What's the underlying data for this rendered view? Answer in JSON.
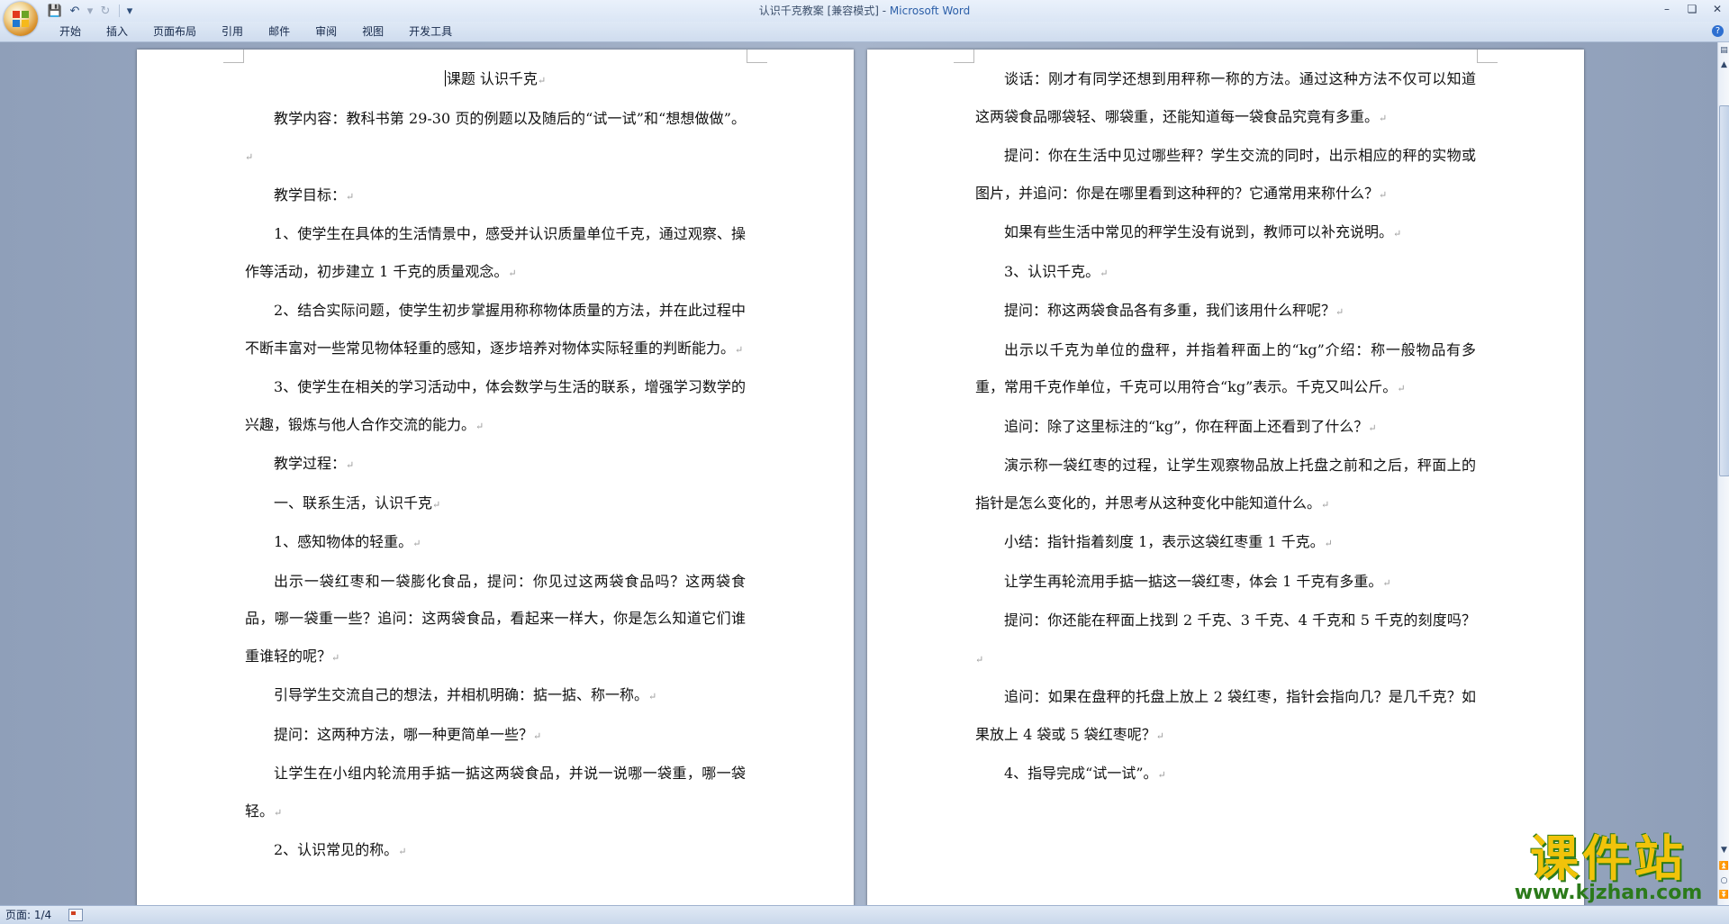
{
  "window": {
    "title_doc": "认识千克教案 [兼容模式] - ",
    "title_app": "Microsoft Word"
  },
  "ribbon": {
    "tabs": [
      "开始",
      "插入",
      "页面布局",
      "引用",
      "邮件",
      "审阅",
      "视图",
      "开发工具"
    ]
  },
  "page_left": {
    "paragraphs": [
      {
        "text": "课题    认识千克",
        "style": "title"
      },
      {
        "text": "教学内容：教科书第 29-30 页的例题以及随后的“试一试”和“想想做做”。"
      },
      {
        "text": "教学目标："
      },
      {
        "text": "1、使学生在具体的生活情景中，感受并认识质量单位千克，通过观察、操作等活动，初步建立 1 千克的质量观念。"
      },
      {
        "text": "2、结合实际问题，使学生初步掌握用称称物体质量的方法，并在此过程中不断丰富对一些常见物体轻重的感知，逐步培养对物体实际轻重的判断能力。"
      },
      {
        "text": "3、使学生在相关的学习活动中，体会数学与生活的联系，增强学习数学的兴趣，锻炼与他人合作交流的能力。"
      },
      {
        "text": "教学过程："
      },
      {
        "text": "一、联系生活，认识千克"
      },
      {
        "text": "1、感知物体的轻重。"
      },
      {
        "text": "出示一袋红枣和一袋膨化食品，提问：你见过这两袋食品吗？这两袋食品，哪一袋重一些？追问：这两袋食品，看起来一样大，你是怎么知道它们谁重谁轻的呢？"
      },
      {
        "text": "引导学生交流自己的想法，并相机明确：掂一掂、称一称。"
      },
      {
        "text": "提问：这两种方法，哪一种更简单一些？"
      },
      {
        "text": "让学生在小组内轮流用手掂一掂这两袋食品，并说一说哪一袋重，哪一袋轻。"
      },
      {
        "text": "2、认识常见的称。"
      }
    ]
  },
  "page_right": {
    "paragraphs": [
      {
        "text": "谈话：刚才有同学还想到用秤称一称的方法。通过这种方法不仅可以知道这两袋食品哪袋轻、哪袋重，还能知道每一袋食品究竟有多重。"
      },
      {
        "text": "提问：你在生活中见过哪些秤？学生交流的同时，出示相应的秤的实物或图片，并追问：你是在哪里看到这种秤的？它通常用来称什么？"
      },
      {
        "text": "如果有些生活中常见的秤学生没有说到，教师可以补充说明。"
      },
      {
        "text": "3、认识千克。"
      },
      {
        "text": "提问：称这两袋食品各有多重，我们该用什么秤呢？"
      },
      {
        "text": "出示以千克为单位的盘秤，并指着秤面上的“kg”介绍：称一般物品有多重，常用千克作单位，千克可以用符合“kg”表示。千克又叫公斤。"
      },
      {
        "text": "追问：除了这里标注的“kg”，你在秤面上还看到了什么？"
      },
      {
        "text": "演示称一袋红枣的过程，让学生观察物品放上托盘之前和之后，秤面上的指针是怎么变化的，并思考从这种变化中能知道什么。"
      },
      {
        "text": "小结：指针指着刻度 1，表示这袋红枣重 1 千克。"
      },
      {
        "text": "让学生再轮流用手掂一掂这一袋红枣，体会 1 千克有多重。"
      },
      {
        "text": "提问：你还能在秤面上找到 2 千克、3 千克、4 千克和 5 千克的刻度吗？"
      },
      {
        "text": "追问：如果在盘秤的托盘上放上 2 袋红枣，指针会指向几？是几千克？如果放上 4 袋或 5 袋红枣呢？"
      },
      {
        "text": "4、指导完成“试一试”。"
      }
    ]
  },
  "status": {
    "page": "页面: 1/4"
  },
  "watermark": {
    "main": "课件站",
    "url": "www.kjzhan.com"
  },
  "paragraph_mark": "↵",
  "icons": [
    "office-button-icon",
    "save-icon",
    "undo-icon",
    "redo-icon",
    "customize-qat-icon",
    "minimize-icon",
    "restore-icon",
    "close-icon",
    "help-icon",
    "scroll-up-icon",
    "scroll-down-icon",
    "view-toggle-icon"
  ]
}
